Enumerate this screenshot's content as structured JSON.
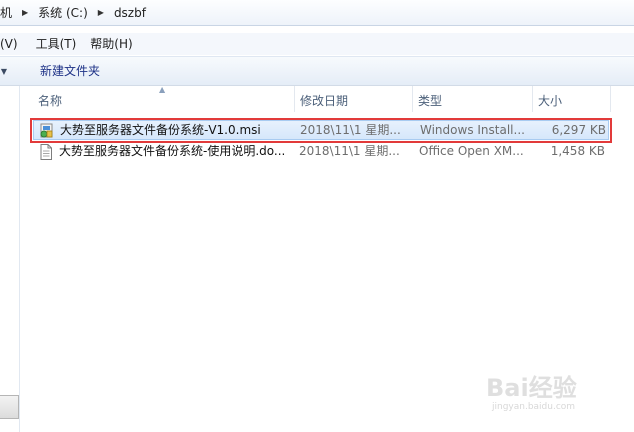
{
  "address": {
    "crumbs": [
      "机",
      "系统 (C:)",
      "dszbf"
    ],
    "separator": "▶"
  },
  "menu": {
    "items": [
      "看(V)",
      "工具(T)",
      "帮助(H)"
    ]
  },
  "toolbar": {
    "new_folder_label": "新建文件夹"
  },
  "columns": {
    "name": "名称",
    "date": "修改日期",
    "type": "类型",
    "size": "大小"
  },
  "files": [
    {
      "name": "大势至服务器文件备份系统-V1.0.msi",
      "date": "2018\\11\\1 星期...",
      "type": "Windows Install...",
      "size": "6,297 KB",
      "icon": "msi-installer-icon",
      "selected": true
    },
    {
      "name": "大势至服务器文件备份系统-使用说明.do...",
      "date": "2018\\11\\1 星期...",
      "type": "Office Open XM...",
      "size": "1,458 KB",
      "icon": "document-icon",
      "selected": false
    }
  ],
  "watermark": {
    "text": "Bai经验",
    "url": "jingyan.baidu.com"
  },
  "colors": {
    "selection_outline": "#e23a3a",
    "selection_fill": "#d6e7fb",
    "toolbar_text": "#1e3287"
  }
}
